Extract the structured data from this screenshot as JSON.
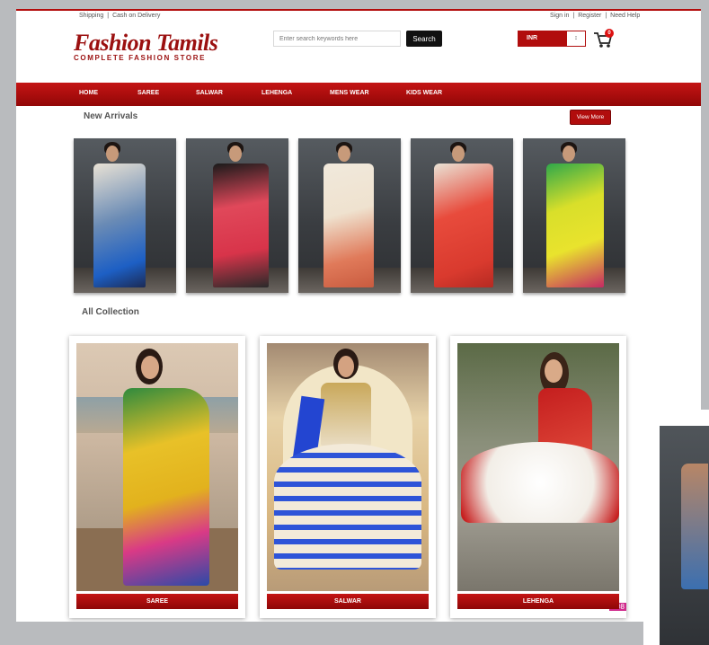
{
  "topbar": {
    "left": [
      "Shipping",
      "Cash on Delivery"
    ],
    "right": [
      "Sign in",
      "Register",
      "Need Help"
    ],
    "separator": "|"
  },
  "logo": {
    "title": "Fashion Tamils",
    "subtitle": "COMPLETE FASHION STORE"
  },
  "search": {
    "placeholder": "Enter search keywords here",
    "button": "Search"
  },
  "currency": {
    "selected": "INR",
    "spinner": "↕"
  },
  "cart": {
    "count": "0",
    "icon": "cart-icon"
  },
  "nav": [
    "HOME",
    "SAREE",
    "SALWAR",
    "LEHENGA",
    "MENS WEAR",
    "KIDS WEAR"
  ],
  "new_arrivals": {
    "title": "New Arrivals",
    "view_more": "View More"
  },
  "all_collection": {
    "title": "All Collection",
    "items": [
      "SAREE",
      "SALWAR",
      "LEHENGA"
    ],
    "watermark": "D#8"
  },
  "colors": {
    "brand_red": "#b10d0d",
    "nav_dark": "#920707"
  }
}
